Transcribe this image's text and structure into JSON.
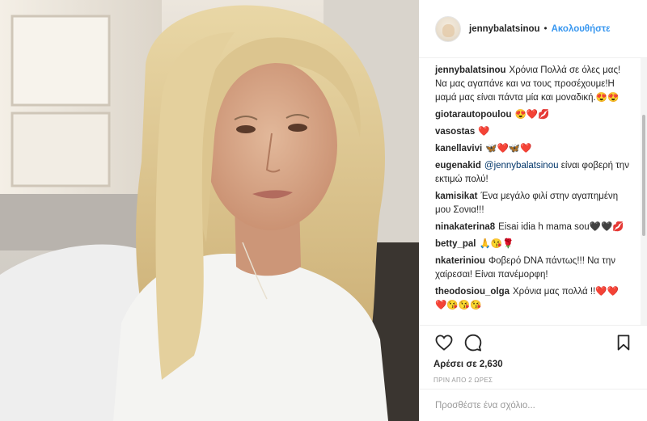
{
  "header": {
    "username": "jennybalatsinou",
    "dot": "•",
    "follow_label": "Ακολουθήστε"
  },
  "comments": [
    {
      "user": "jennybalatsinou",
      "text": "Χρόνια Πολλά σε όλες μας!Να μας αγαπάνε και να τους προσέχουμε!Η μαμά μας είναι πάντα μία και μοναδική.😍😍"
    },
    {
      "user": "giotarautopoulou",
      "text": "😍❤️💋"
    },
    {
      "user": "vasostas",
      "text": "❤️"
    },
    {
      "user": "kanellavivi",
      "text": "🦋❤️🦋❤️"
    },
    {
      "user": "eugenakid",
      "mention": "@jennybalatsinou",
      "text": " είναι φοβερή την εκτιμώ πολύ!"
    },
    {
      "user": "kamisikat",
      "text": "Ένα μεγάλο φιλί στην αγαπημένη μου Σονια!!!"
    },
    {
      "user": "ninakaterina8",
      "text": "Eisai idia h mama sou🖤🖤💋"
    },
    {
      "user": "betty_pal",
      "text": "🙏😘🌹"
    },
    {
      "user": "nkateriniou",
      "text": "Φοβερό DNA πάντως!!! Να την χαίρεσαι! Είναι πανέμορφη!"
    },
    {
      "user": "theodosiou_olga",
      "text": "Χρόνια μας πολλά !!❤️❤️❤️😘😘😘"
    }
  ],
  "actions": {
    "likes": "Αρέσει σε 2,630",
    "time": "ΠΡΙΝ ΑΠΟ 2 ΩΡΕΣ"
  },
  "add_comment": {
    "placeholder": "Προσθέστε ένα σχόλιο..."
  },
  "icons": {
    "like": "heart-icon",
    "comment": "comment-bubble-icon",
    "save": "bookmark-icon"
  }
}
